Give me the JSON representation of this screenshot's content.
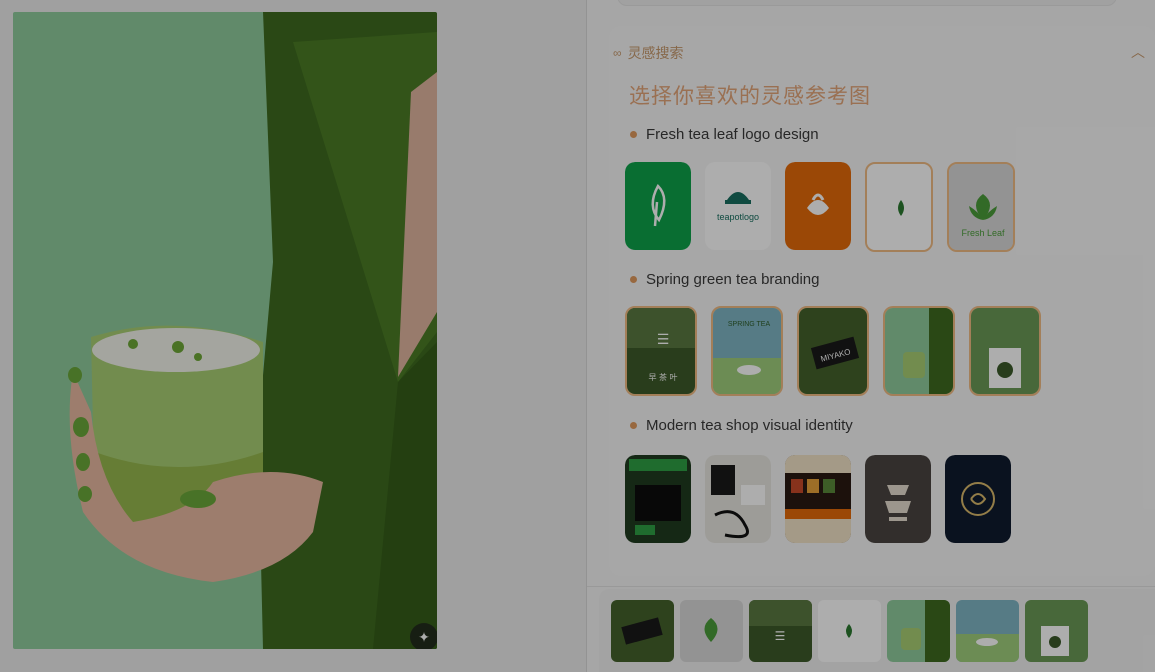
{
  "main_image": {
    "alt": "Woman in green shirt holding a glass of matcha latte"
  },
  "magic_button": {
    "icon": "magic-wand-icon"
  },
  "section": {
    "icon": "infinity-icon",
    "title": "灵感搜索",
    "collapse_icon": "chevron-up-icon"
  },
  "inspiration_title": "选择你喜欢的灵感参考图",
  "groups": [
    {
      "label": "Fresh tea leaf logo design"
    },
    {
      "label": "Spring green tea branding"
    },
    {
      "label": "Modern tea shop visual identity"
    }
  ],
  "thumb_text": {
    "teapot": "teapotlogo",
    "fresh_leaf": "Fresh Leaf",
    "spring": "SPRING TEA",
    "miyako": "MIYAKO",
    "chinese": "早 茶 叶"
  },
  "colors": {
    "accent": "#e3a679",
    "selected_border": "#f0bb84",
    "green": "#0ea24a",
    "orange": "#e56b0a"
  }
}
